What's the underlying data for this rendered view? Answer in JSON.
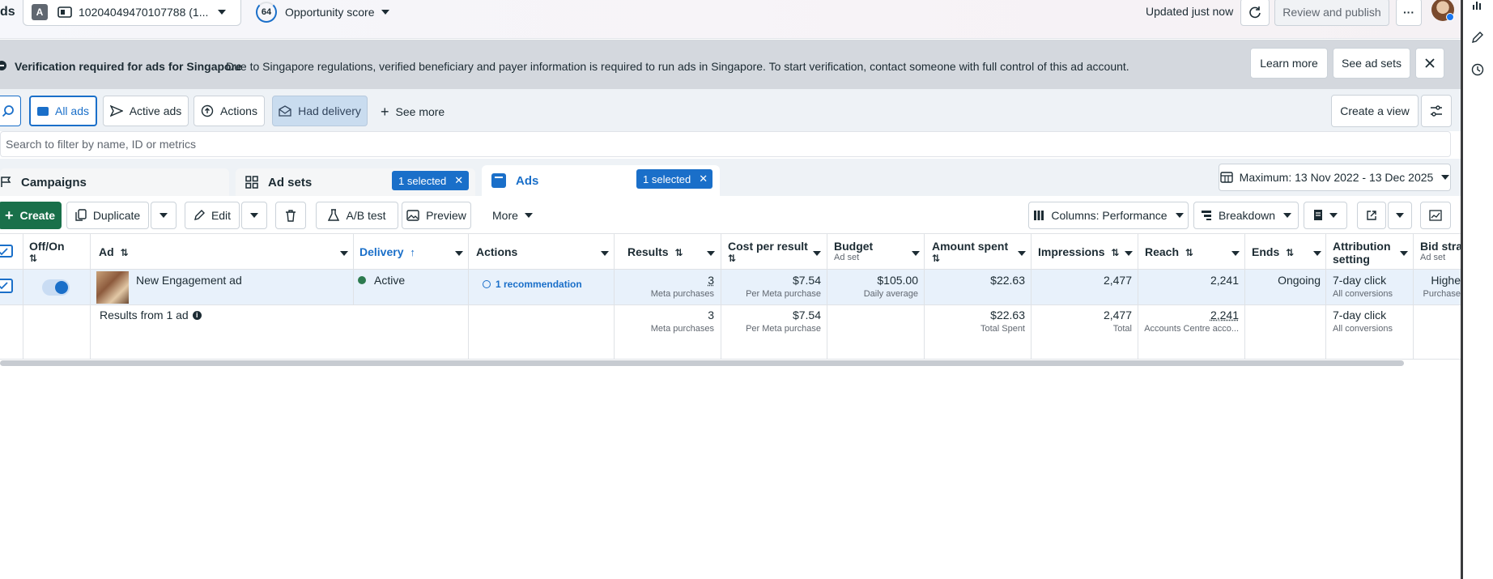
{
  "header": {
    "app_title": "ds",
    "account_initial": "A",
    "account_id": "10204049470107788 (1...",
    "opportunity_score_value": "64",
    "opportunity_score_label": "Opportunity score",
    "updated_text": "Updated just now",
    "review_publish_label": "Review and publish",
    "more_label": "···"
  },
  "banner": {
    "title": "Verification required for ads for Singapore",
    "message": "Due to Singapore regulations, verified beneficiary and payer information is required to run ads in Singapore. To start verification, contact someone with full control of this ad account.",
    "learn_more": "Learn more",
    "see_ad_sets": "See ad sets"
  },
  "filters": {
    "all_ads": "All ads",
    "active_ads": "Active ads",
    "actions": "Actions",
    "had_delivery": "Had delivery",
    "see_more": "See more",
    "create_view": "Create a view"
  },
  "search": {
    "placeholder": "Search to filter by name, ID or metrics"
  },
  "tabs": {
    "campaigns": "Campaigns",
    "ad_sets": "Ad sets",
    "ad_sets_selected": "1 selected",
    "ads": "Ads",
    "ads_selected": "1 selected",
    "date_range": "Maximum: 13 Nov 2022 - 13 Dec 2025"
  },
  "toolbar": {
    "create": "Create",
    "duplicate": "Duplicate",
    "edit": "Edit",
    "ab_test": "A/B test",
    "preview": "Preview",
    "more": "More",
    "columns": "Columns: Performance",
    "breakdown": "Breakdown"
  },
  "table": {
    "headers": {
      "offon": "Off/On",
      "ad": "Ad",
      "delivery": "Delivery",
      "actions": "Actions",
      "results": "Results",
      "cost_per_result": "Cost per result",
      "budget": "Budget",
      "budget_sub": "Ad set",
      "amount_spent": "Amount spent",
      "impressions": "Impressions",
      "reach": "Reach",
      "ends": "Ends",
      "attribution_1": "Attribution",
      "attribution_2": "setting",
      "bid_strategy": "Bid stra",
      "bid_strategy_sub": "Ad set"
    },
    "row": {
      "ad_name": "New Engagement ad",
      "delivery": "Active",
      "recommendation": "1 recommendation",
      "results": "3",
      "results_sub": "Meta purchases",
      "cost": "$7.54",
      "cost_sub": "Per Meta purchase",
      "budget": "$105.00",
      "budget_sub": "Daily average",
      "amount_spent": "$22.63",
      "impressions": "2,477",
      "reach": "2,241",
      "ends": "Ongoing",
      "attribution": "7-day click",
      "attribution_sub": "All conversions",
      "bid": "Highe",
      "bid_sub": "Purchase"
    },
    "summary": {
      "label": "Results from 1 ad",
      "results": "3",
      "results_sub": "Meta purchases",
      "cost": "$7.54",
      "cost_sub": "Per Meta purchase",
      "amount_spent": "$22.63",
      "amount_spent_sub": "Total Spent",
      "impressions": "2,477",
      "impressions_sub": "Total",
      "reach": "2,241",
      "reach_sub": "Accounts Centre acco...",
      "attribution": "7-day click",
      "attribution_sub": "All conversions"
    }
  },
  "colors": {
    "brand_blue": "#1a6fc9",
    "create_green": "#19704a",
    "active_green": "#2d7b4f",
    "banner_bg": "#d4d8de"
  }
}
